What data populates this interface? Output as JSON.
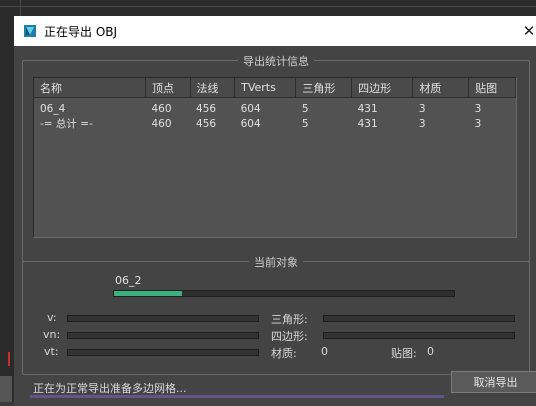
{
  "window": {
    "title": "正在导出 OBJ",
    "close_glyph": "✕",
    "icon": "3dsmax-app-icon"
  },
  "stats_group": {
    "title": "导出统计信息",
    "columns": [
      "名称",
      "顶点",
      "法线",
      "TVerts",
      "三角形",
      "四边形",
      "材质",
      "贴图"
    ],
    "rows": [
      [
        "06_4",
        "460",
        "456",
        "604",
        "5",
        "431",
        "3",
        "3"
      ],
      [
        "-= 总计 =-",
        "460",
        "456",
        "604",
        "5",
        "431",
        "3",
        "3"
      ]
    ]
  },
  "current_group": {
    "title": "当前对象",
    "object_name": "06_2",
    "progress": 0.2,
    "progress_color": "#3bb07e",
    "v_label": "v:",
    "vn_label": "vn:",
    "vt_label": "vt:",
    "tri_label": "三角形:",
    "quad_label": "四边形:",
    "mat_label": "材质:",
    "mat_value": "0",
    "map_label": "贴图:",
    "map_value": "0"
  },
  "status": {
    "text": "正在为正常导出准备多边网格..."
  },
  "buttons": {
    "cancel_label": "取消导出"
  }
}
